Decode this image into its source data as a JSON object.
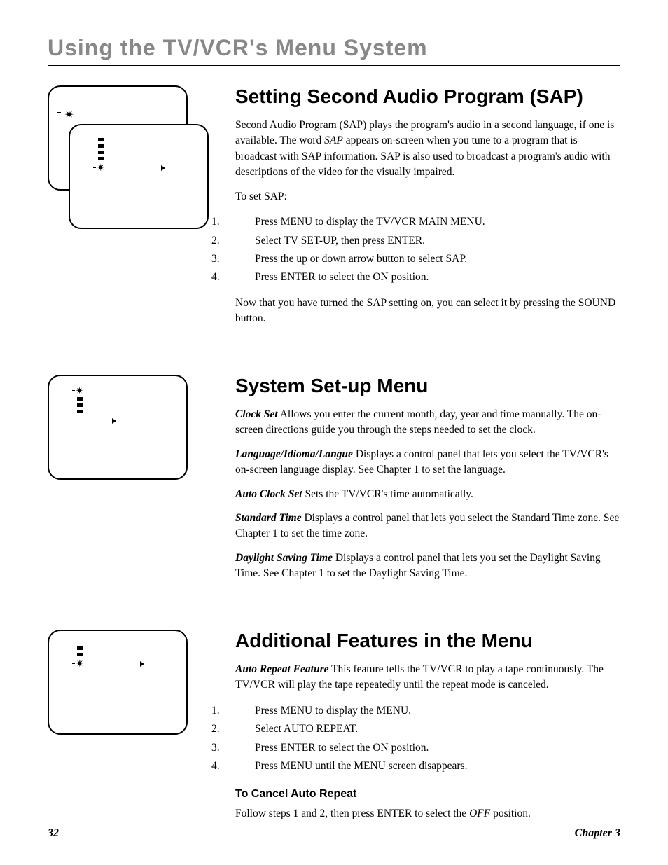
{
  "section_title": "Using the TV/VCR's Menu System",
  "sap": {
    "heading": "Setting Second Audio Program (SAP)",
    "intro_a": "Second Audio Program (SAP) plays the program's audio in a second language, if one is available. The word ",
    "intro_ital": "SAP",
    "intro_b": " appears on-screen when you tune to a program that is broadcast with SAP information. SAP is also used to broadcast a program's audio with descriptions of the video for the visually impaired.",
    "to_set": "To set SAP:",
    "step1_a": "Press MENU to display the ",
    "step1_i": "TV/VCR MAIN MENU",
    "step1_b": ".",
    "step2_a": "Select ",
    "step2_i": "TV SET-UP",
    "step2_b": ", then press ENTER.",
    "step3_a": "Press the up or down arrow button to select ",
    "step3_i": "SAP",
    "step3_b": ".",
    "step4_a": "Press ENTER to select the ",
    "step4_i": "ON",
    "step4_b": " position.",
    "outro": "Now that you have turned the SAP setting on, you can select it by pressing the SOUND button."
  },
  "sys": {
    "heading": "System Set-up Menu",
    "clock_t": "Clock Set",
    "clock_b": "   Allows you enter the current month, day, year and time manually. The on-screen directions guide you through the steps needed to set the clock.",
    "lang_t": "Language/Idioma/Langue",
    "lang_b": "   Displays a control panel that lets you select the TV/VCR's on-screen language display. See Chapter 1 to set the language.",
    "auto_t": "Auto Clock Set",
    "auto_b": "   Sets the TV/VCR's time automatically.",
    "std_t": "Standard Time",
    "std_b": "   Displays a control panel that lets you select the Standard Time zone. See Chapter 1 to set the time zone.",
    "dst_t": "Daylight Saving Time",
    "dst_b": "   Displays a control panel that lets you set the Daylight Saving Time. See Chapter 1 to set the Daylight Saving Time."
  },
  "add": {
    "heading": "Additional Features in the Menu",
    "ar_t": "Auto Repeat Feature",
    "ar_b": "   This feature tells the TV/VCR to play a tape continuously. The TV/VCR will play the tape repeatedly until the repeat mode is canceled.",
    "s1_a": "Press MENU to display the ",
    "s1_i": "MENU",
    "s1_b": ".",
    "s2_a": "Select ",
    "s2_i": "AUTO REPEAT",
    "s2_b": ".",
    "s3_a": "Press ENTER to select the ",
    "s3_i": "ON",
    "s3_b": " position.",
    "s4_a": "Press MENU until the ",
    "s4_i": "MENU",
    "s4_b": " screen disappears.",
    "cancel_h": "To Cancel Auto Repeat",
    "cancel_a": "Follow steps 1 and 2, then press ENTER to select the ",
    "cancel_i": "OFF",
    "cancel_b": " position."
  },
  "footer": {
    "page": "32",
    "chapter": "Chapter 3"
  }
}
